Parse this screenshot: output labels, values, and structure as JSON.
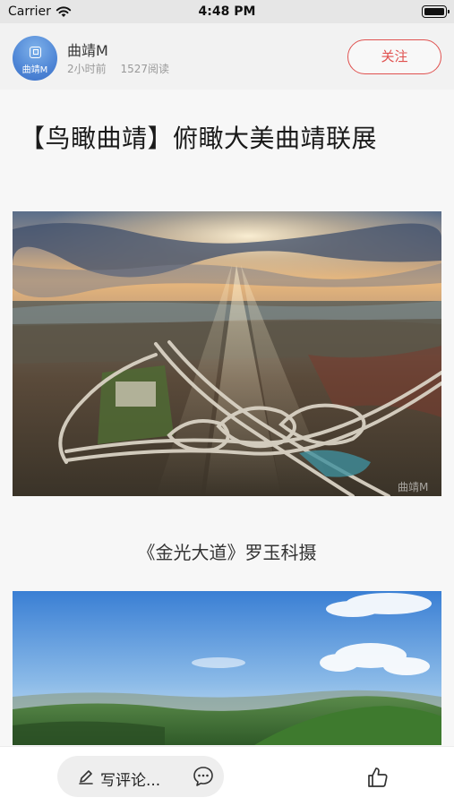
{
  "status_bar": {
    "carrier": "Carrier",
    "time": "4:48 PM"
  },
  "author": {
    "avatar_text": "曲靖M",
    "name": "曲靖M",
    "time_ago": "2小时前",
    "reads": "1527阅读",
    "follow_label": "关注"
  },
  "article": {
    "title": "【鸟瞰曲靖】俯瞰大美曲靖联展",
    "photo_1_watermark": "曲靖M",
    "caption_1": "《金光大道》罗玉科摄"
  },
  "bottom_bar": {
    "comment_placeholder": "写评论..."
  },
  "colors": {
    "accent": "#e0514f",
    "avatar": "#4f86d6"
  }
}
